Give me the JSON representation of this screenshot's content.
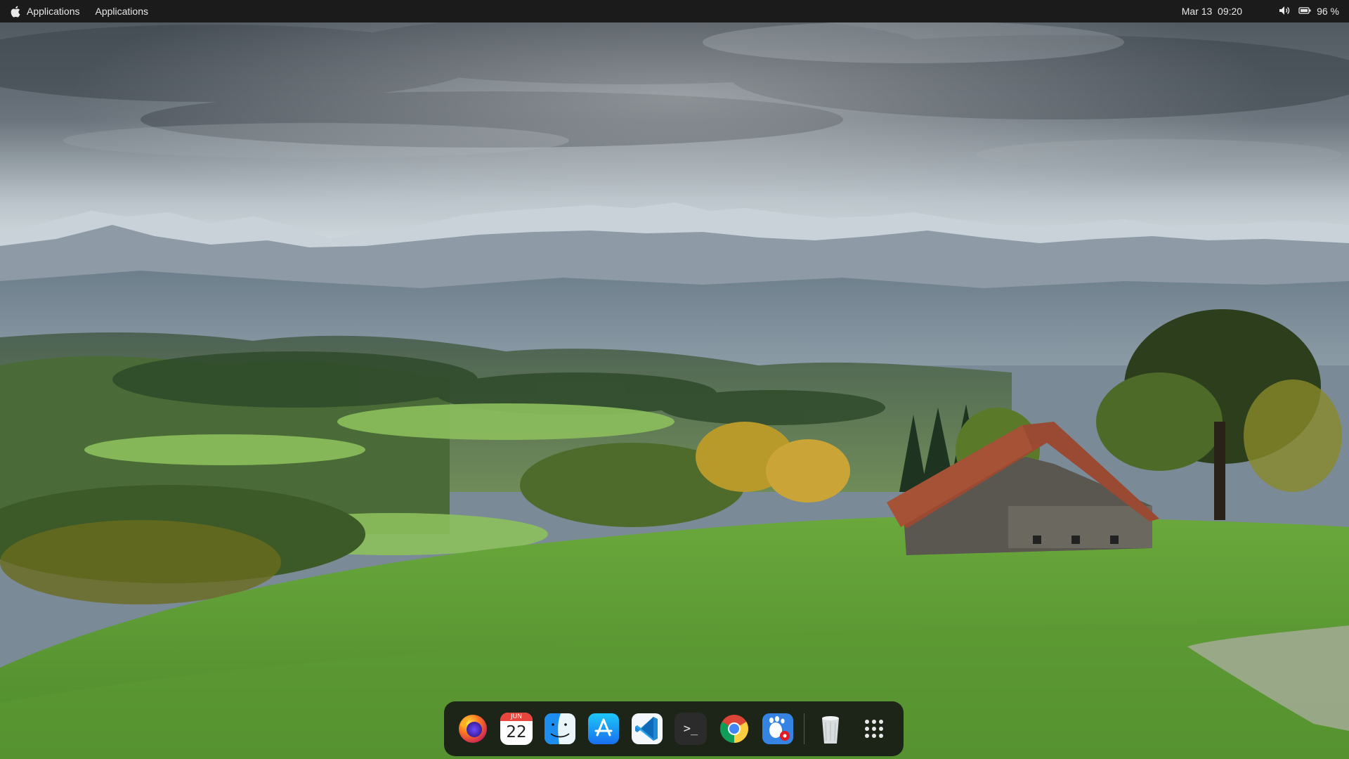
{
  "topbar": {
    "apple_icon": "apple-logo-icon",
    "menu1": "Applications",
    "menu2": "Applications",
    "clock": "Mar 13  09:20",
    "volume_icon": "speaker-icon",
    "battery_icon": "battery-icon",
    "battery_percent": "96 %"
  },
  "dock": {
    "items": [
      {
        "name": "firefox",
        "icon": "firefox-icon"
      },
      {
        "name": "calendar",
        "icon": "calendar-icon",
        "month": "JUN",
        "day": "22"
      },
      {
        "name": "finder",
        "icon": "finder-icon"
      },
      {
        "name": "app-store",
        "icon": "app-store-icon"
      },
      {
        "name": "vscode",
        "icon": "vscode-icon"
      },
      {
        "name": "terminal",
        "icon": "terminal-icon",
        "glyph": ">_"
      },
      {
        "name": "chrome",
        "icon": "chrome-icon"
      },
      {
        "name": "gnome-settings",
        "icon": "gnome-settings-icon"
      },
      {
        "name": "trash",
        "icon": "trash-icon"
      },
      {
        "name": "show-apps",
        "icon": "grid-icon"
      }
    ]
  },
  "wallpaper": {
    "subject": "alpine-meadow-with-barn",
    "sky_color": "#5e6770",
    "grass_color": "#5d9a35",
    "roof_color": "#9a4a32"
  }
}
